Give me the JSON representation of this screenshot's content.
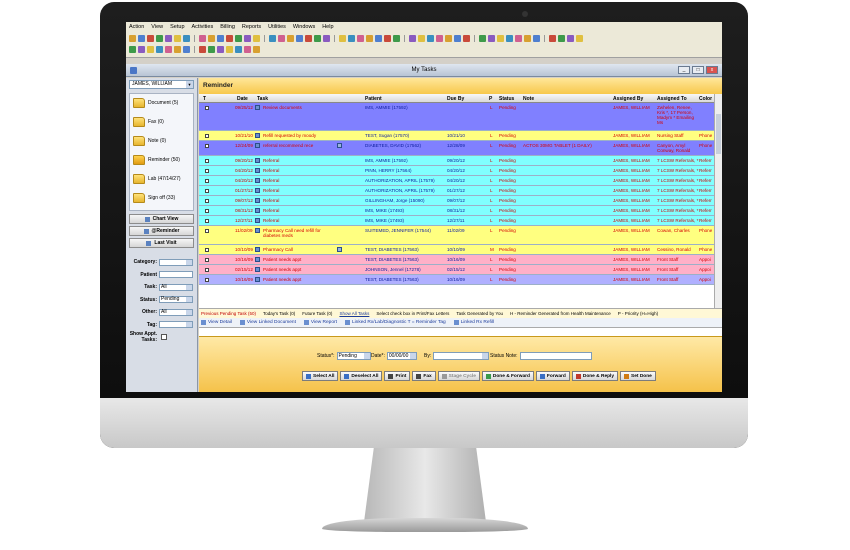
{
  "menu": [
    "Action",
    "View",
    "Setup",
    "Activities",
    "Billing",
    "Reports",
    "Utilities",
    "Windows",
    "Help"
  ],
  "window": {
    "title": "My Tasks",
    "buttons": [
      "_",
      "□",
      "x"
    ]
  },
  "user": "JAMES, WILLIAM",
  "section_title": "Reminder",
  "folders": [
    {
      "label": "Document (5)"
    },
    {
      "label": "Fax (0)"
    },
    {
      "label": "Note (0)"
    },
    {
      "label": "Reminder (50)"
    },
    {
      "label": "Lab (47/14/27)"
    },
    {
      "label": "Sign off (33)"
    }
  ],
  "side_buttons": [
    "Chart View",
    "@Reminder",
    "Last Visit"
  ],
  "filters": [
    {
      "label": "Category:",
      "value": ""
    },
    {
      "label": "Patient",
      "value": ""
    },
    {
      "label": "Task:",
      "value": "All"
    },
    {
      "label": "Status:",
      "value": "Pending"
    },
    {
      "label": "Other:",
      "value": "All"
    },
    {
      "label": "Tag:",
      "value": ""
    },
    {
      "label": "Show Appt. Tasks:",
      "value": ""
    }
  ],
  "columns": [
    "T",
    "Date",
    "Task",
    "Patient",
    "Due By",
    "P",
    "Status",
    "Note",
    "Assigned By",
    "Assigned To",
    "Color"
  ],
  "colors": {
    "purple": "#8080ff",
    "yellow": "#ffff80",
    "cyan": "#80ffff",
    "pink": "#ffb0c8",
    "lavender": "#b0b0ff",
    "red_text": "#d40000",
    "blue_text": "#1020a0"
  },
  "rows": [
    {
      "color": "purple",
      "text": "red_text",
      "tall": 3,
      "date": "09/25/12",
      "task": "Review documents",
      "patient": "IMS, AMMIE (17592)",
      "due": "",
      "p": "L",
      "status": "Pending",
      "note": "",
      "by": "JAMES, WILLIAM",
      "to": "Zwhelen, Renee, Kris *, 17 Person, Madym * Emailing Ms",
      "color_col": ""
    },
    {
      "color": "yellow",
      "text": "red_text",
      "tall": 1,
      "date": "10/21/10",
      "task": "Refill requested by moody",
      "patient": "TEST, Sugan (17570)",
      "due": "10/21/10",
      "p": "L",
      "status": "Pending",
      "note": "",
      "by": "JAMES, WILLIAM",
      "to": "Nursing Staff",
      "color_col": "Phone"
    },
    {
      "color": "purple",
      "text": "red_text",
      "tall": 1.5,
      "date": "12/24/09",
      "task": "referral recommend rece",
      "patient": "DIABETES, DAVID (17562)",
      "due": "12/28/09",
      "p": "L",
      "status": "Pending",
      "note": "ACTOS 30MG TABLET (1 DAILY)",
      "by": "JAMES, WILLIAM",
      "to": "Canyon, Amyl Conway, Ronald",
      "color_col": "Phone"
    },
    {
      "color": "cyan",
      "text": "red_text",
      "tall": 1,
      "date": "09/20/12",
      "task": "Referral",
      "patient": "IMS, AMMIE (17592)",
      "due": "09/20/12",
      "p": "L",
      "status": "Pending",
      "note": "",
      "by": "JAMES, WILLIAM",
      "to": "7 LCSW Referrals, *",
      "color_col": "Referr"
    },
    {
      "color": "cyan",
      "text": "red_text",
      "tall": 1,
      "date": "04/20/12",
      "task": "Referral",
      "patient": "PINN, HERRY (17564)",
      "due": "04/20/12",
      "p": "L",
      "status": "Pending",
      "note": "",
      "by": "JAMES, WILLIAM",
      "to": "7 LCSW Referrals, *",
      "color_col": "Referr"
    },
    {
      "color": "cyan",
      "text": "red_text",
      "tall": 1,
      "date": "04/20/12",
      "task": "Referral",
      "patient": "AUTHORIZATION, APRIL (17579)",
      "due": "04/20/12",
      "p": "L",
      "status": "Pending",
      "note": "",
      "by": "JAMES, WILLIAM",
      "to": "7 LCSW Referrals, *",
      "color_col": "Referr"
    },
    {
      "color": "cyan",
      "text": "red_text",
      "tall": 1,
      "date": "01/27/12",
      "task": "Referral",
      "patient": "AUTHORIZATION, APRIL (17579)",
      "due": "01/27/12",
      "p": "L",
      "status": "Pending",
      "note": "",
      "by": "JAMES, WILLIAM",
      "to": "7 LCSW Referrals, *",
      "color_col": "Referr"
    },
    {
      "color": "cyan",
      "text": "red_text",
      "tall": 1,
      "date": "09/07/12",
      "task": "Referral",
      "patient": "GILLINGHAM, Jorge (15090)",
      "due": "09/07/12",
      "p": "L",
      "status": "Pending",
      "note": "",
      "by": "JAMES, WILLIAM",
      "to": "7 LCSW Referrals, *",
      "color_col": "Referr"
    },
    {
      "color": "cyan",
      "text": "red_text",
      "tall": 1,
      "date": "08/31/12",
      "task": "Referral",
      "patient": "IMS, MIKE (17493)",
      "due": "08/31/12",
      "p": "L",
      "status": "Pending",
      "note": "",
      "by": "JAMES, WILLIAM",
      "to": "7 LCSW Referrals, *",
      "color_col": "Referr"
    },
    {
      "color": "cyan",
      "text": "red_text",
      "tall": 1,
      "date": "12/27/11",
      "task": "Referral",
      "patient": "IMS, MIKE (17493)",
      "due": "12/27/11",
      "p": "L",
      "status": "Pending",
      "note": "",
      "by": "JAMES, WILLIAM",
      "to": "7 LCSW Referrals, *",
      "color_col": "Referr"
    },
    {
      "color": "yellow",
      "text": "red_text",
      "tall": 2,
      "date": "11/02/09",
      "task": "Pharmacy Call need refill for diabetes meds",
      "patient": "SUITEMED, JENNIFER (17544)",
      "due": "11/02/09",
      "p": "L",
      "status": "Pending",
      "note": "",
      "by": "JAMES, WILLIAM",
      "to": "Cowan, Charles",
      "color_col": "Phone"
    },
    {
      "color": "yellow",
      "text": "red_text",
      "tall": 1,
      "date": "10/10/09",
      "task": "Pharmacy Call",
      "patient": "TEST, DIABETES (17563)",
      "due": "10/10/09",
      "p": "M",
      "status": "Pending",
      "note": "",
      "by": "JAMES, WILLIAM",
      "to": "Cessino, Ronald",
      "color_col": "Phone"
    },
    {
      "color": "pink",
      "text": "red_text",
      "tall": 1,
      "date": "10/16/09",
      "task": "Patient needs appt",
      "patient": "TEST, DIABETES (17563)",
      "due": "10/16/09",
      "p": "L",
      "status": "Pending",
      "note": "",
      "by": "JAMES, WILLIAM",
      "to": "Front Staff",
      "color_col": "Appoi"
    },
    {
      "color": "pink",
      "text": "red_text",
      "tall": 1,
      "date": "02/15/12",
      "task": "Patient needs appt",
      "patient": "JOHNSON, Jennel (17278)",
      "due": "02/15/12",
      "p": "L",
      "status": "Pending",
      "note": "",
      "by": "JAMES, WILLIAM",
      "to": "Front Staff",
      "color_col": "Appoi"
    },
    {
      "color": "lavender",
      "text": "red_text",
      "tall": 1,
      "date": "10/16/09",
      "task": "Patient needs appt",
      "patient": "TEST, DIABETES (17563)",
      "due": "10/16/09",
      "p": "L",
      "status": "Pending",
      "note": "",
      "by": "JAMES, WILLIAM",
      "to": "Front Staff",
      "color_col": "Appoi"
    }
  ],
  "legend": {
    "prev": "Previous Pending Task (50)",
    "today": "Today's Task (0)",
    "future": "Future Task (0)",
    "show_all": "Show All Tasks",
    "select_check": "Select check box in Print/Fax Letters",
    "generated": "Task Generated by You",
    "health": "H - Reminder Generated from Health Maintenance",
    "priority": "P - Priority (H=High)"
  },
  "links": [
    "View Detail",
    "View Linked Document",
    "View Report",
    "Linked Rx/Lab/Diagnostic  T = Reminder Tag",
    "Linked Rx Refill"
  ],
  "status_bar": {
    "status_label": "Status*:",
    "status_value": "Pending",
    "date_label": "Date*:",
    "date_value": "00/00/00",
    "by_label": "By:",
    "by_value": "",
    "note_label": "Status Note:",
    "note_value": ""
  },
  "actions": [
    "Select All",
    "Deselect All",
    "Print",
    "Fax",
    "Stage Cycle",
    "Done & Forward",
    "Forward",
    "Done & Reply",
    "Set Done"
  ]
}
